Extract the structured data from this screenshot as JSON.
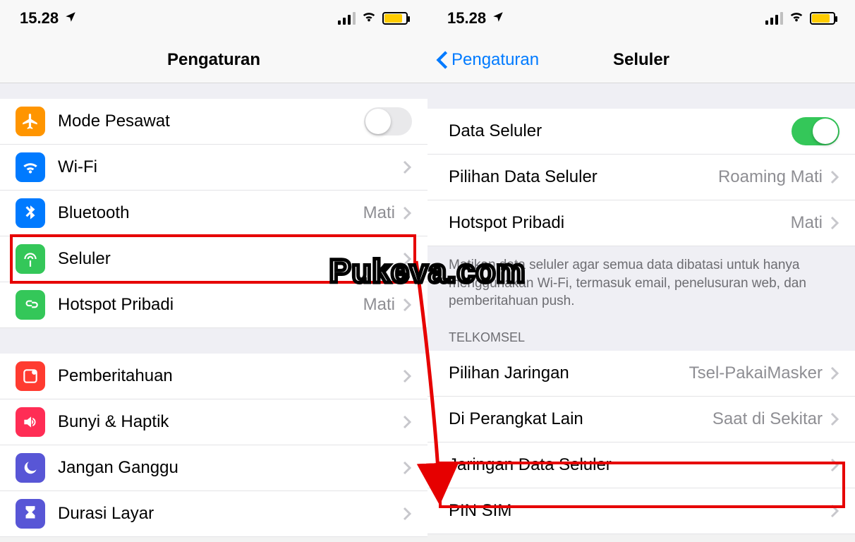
{
  "statusbar": {
    "time": "15.28"
  },
  "left": {
    "title": "Pengaturan",
    "rows": {
      "airplane": {
        "label": "Mode Pesawat"
      },
      "wifi": {
        "label": "Wi-Fi"
      },
      "bluetooth": {
        "label": "Bluetooth",
        "value": "Mati"
      },
      "cellular": {
        "label": "Seluler"
      },
      "hotspot": {
        "label": "Hotspot Pribadi",
        "value": "Mati"
      },
      "notifications": {
        "label": "Pemberitahuan"
      },
      "sounds": {
        "label": "Bunyi & Haptik"
      },
      "dnd": {
        "label": "Jangan Ganggu"
      },
      "screentime": {
        "label": "Durasi Layar"
      }
    }
  },
  "right": {
    "back": "Pengaturan",
    "title": "Seluler",
    "rows": {
      "cellular_data": {
        "label": "Data Seluler"
      },
      "data_options": {
        "label": "Pilihan Data Seluler",
        "value": "Roaming Mati"
      },
      "hotspot": {
        "label": "Hotspot Pribadi",
        "value": "Mati"
      }
    },
    "footer": "Matikan data seluler agar semua data dibatasi untuk hanya menggunakan Wi-Fi, termasuk email, penelusuran web, dan pemberitahuan push.",
    "carrier_section": "TELKOMSEL",
    "carrier_rows": {
      "network_selection": {
        "label": "Pilihan Jaringan",
        "value": "Tsel-PakaiMasker"
      },
      "other_devices": {
        "label": "Di Perangkat Lain",
        "value": "Saat di Sekitar"
      },
      "data_network": {
        "label": "Jaringan Data Seluler"
      },
      "sim_pin": {
        "label": "PIN SIM"
      }
    }
  },
  "watermark": "Pukeva.com"
}
